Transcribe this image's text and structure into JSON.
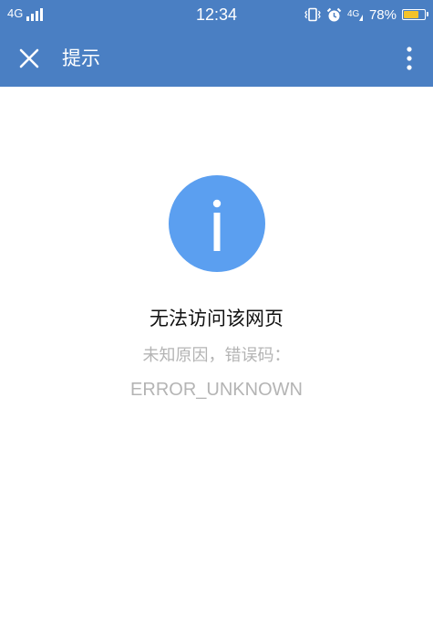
{
  "status_bar": {
    "network_left": "4G",
    "signal_bars": 4,
    "time": "12:34",
    "network_right": "4G",
    "battery_percent": "78%",
    "battery_level": 0.78,
    "battery_fill_color": "#f3c229",
    "icons": [
      "signal-icon",
      "vibrate-icon",
      "alarm-icon",
      "signal-icon",
      "battery-icon"
    ]
  },
  "toolbar": {
    "title": "提示",
    "close_icon": "close-icon",
    "more_icon": "more-vertical-icon",
    "background_color": "#4a7fc3"
  },
  "error": {
    "icon": "info-icon",
    "icon_color": "#5b9ff0",
    "title": "无法访问该网页",
    "subtitle": "未知原因，错误码：",
    "code": "ERROR_UNKNOWN"
  }
}
